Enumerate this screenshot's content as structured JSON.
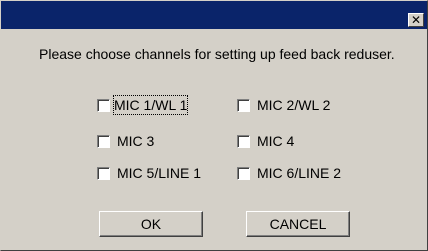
{
  "dialog": {
    "close_glyph": "✕",
    "close_icon": "close-icon",
    "prompt": "Please choose channels for setting up feed back reduser."
  },
  "channels": [
    {
      "label": "MIC 1/WL 1",
      "checked": false,
      "focused": true
    },
    {
      "label": "MIC 2/WL 2",
      "checked": false
    },
    {
      "label": "MIC 3",
      "checked": false
    },
    {
      "label": "MIC 4",
      "checked": false
    },
    {
      "label": "MIC 5/LINE 1",
      "checked": false
    },
    {
      "label": "MIC 6/LINE 2",
      "checked": false
    }
  ],
  "buttons": {
    "ok_label": "OK",
    "cancel_label": "CANCEL"
  },
  "colors": {
    "titlebar": "#0a246a",
    "dialog_face": "#d4d0c8"
  }
}
